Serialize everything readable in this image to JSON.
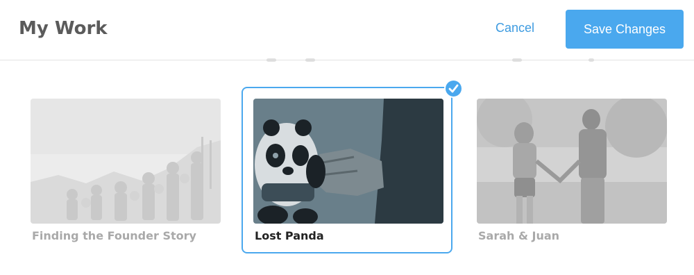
{
  "header": {
    "title": "My Work",
    "cancel_label": "Cancel",
    "save_label": "Save Changes"
  },
  "projects": [
    {
      "caption": "Finding the Founder Story",
      "selected": false,
      "thumbnail_icon": "statue-relief-image"
    },
    {
      "caption": "Lost Panda",
      "selected": true,
      "thumbnail_icon": "panda-toy-image"
    },
    {
      "caption": "Sarah & Juan",
      "selected": false,
      "thumbnail_icon": "couple-walking-image"
    }
  ],
  "colors": {
    "accent": "#4aa8ee",
    "title": "#5b5b5b",
    "muted_caption": "#a9a9a9",
    "selected_caption": "#222222"
  }
}
